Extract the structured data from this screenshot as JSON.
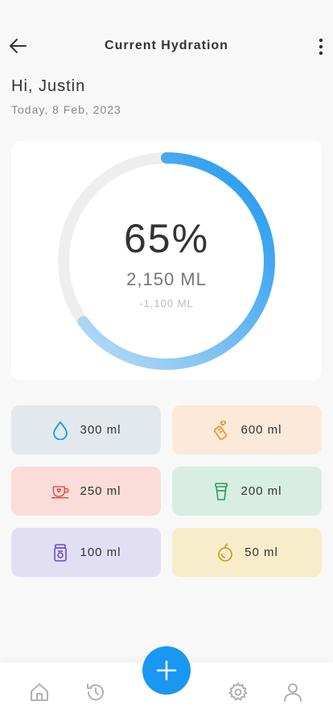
{
  "header": {
    "title": "Current Hydration",
    "back_icon": "arrow-left-icon",
    "more_icon": "more-vertical-icon"
  },
  "user": {
    "greeting": "Hi, Justin",
    "date": "Today, 8 Feb, 2023"
  },
  "progress": {
    "percent_label": "65%",
    "percent_value": 0.65,
    "amount": "2,150 ML",
    "remaining": "-1,100 ML",
    "track_color": "#eeeeee",
    "gradient_start": "#bcdcf4",
    "gradient_end": "#1a97f0"
  },
  "drinks": [
    {
      "label": "300 ml",
      "icon": "water-drop-icon",
      "bg": "#e2e8eb",
      "color": "#1a97f0"
    },
    {
      "label": "600 ml",
      "icon": "bottle-icon",
      "bg": "#fde9d9",
      "color": "#f08a2a"
    },
    {
      "label": "250 ml",
      "icon": "coffee-cup-icon",
      "bg": "#fadcd8",
      "color": "#e0453a"
    },
    {
      "label": "200 ml",
      "icon": "cup-icon",
      "bg": "#d8eee3",
      "color": "#2f9a5e"
    },
    {
      "label": "100 ml",
      "icon": "jar-icon",
      "bg": "#e2dff5",
      "color": "#6d4ad1"
    },
    {
      "label": "50 ml",
      "icon": "fruit-icon",
      "bg": "#f8edcb",
      "color": "#c99612"
    }
  ],
  "nav": {
    "home_icon": "home-icon",
    "history_icon": "history-icon",
    "add_icon": "plus-icon",
    "settings_icon": "gear-icon",
    "profile_icon": "user-icon",
    "accent": "#1a97f0"
  }
}
